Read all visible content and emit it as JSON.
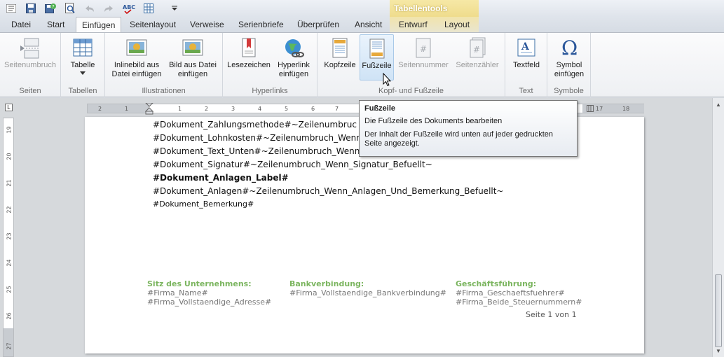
{
  "quick_access": {
    "items": [
      {
        "name": "app-menu-icon"
      },
      {
        "name": "save-icon"
      },
      {
        "name": "save-as-icon"
      },
      {
        "name": "print-preview-icon"
      },
      {
        "name": "undo-icon"
      },
      {
        "name": "redo-icon"
      },
      {
        "name": "spellcheck-icon",
        "label": "ABC"
      },
      {
        "name": "table-grid-icon"
      },
      {
        "name": "customize-dropdown-icon"
      }
    ],
    "contextual_title": "Tabellentools"
  },
  "tabs": [
    {
      "label": "Datei"
    },
    {
      "label": "Start"
    },
    {
      "label": "Einfügen",
      "active": true
    },
    {
      "label": "Seitenlayout"
    },
    {
      "label": "Verweise"
    },
    {
      "label": "Serienbriefe"
    },
    {
      "label": "Überprüfen"
    },
    {
      "label": "Ansicht"
    },
    {
      "label": "Entwurf"
    },
    {
      "label": "Layout"
    }
  ],
  "ribbon": {
    "groups": {
      "seiten": {
        "label": "Seiten",
        "buttons": {
          "seitenumbruch": "Seitenumbruch"
        }
      },
      "tabellen": {
        "label": "Tabellen",
        "buttons": {
          "tabelle": "Tabelle"
        }
      },
      "illustrationen": {
        "label": "Illustrationen",
        "buttons": {
          "inlinebild_l1": "Inlinebild aus",
          "inlinebild_l2": "Datei einfügen",
          "bild_l1": "Bild aus Datei",
          "bild_l2": "einfügen"
        }
      },
      "hyperlinks": {
        "label": "Hyperlinks",
        "buttons": {
          "lesezeichen": "Lesezeichen",
          "hyperlink_l1": "Hyperlink",
          "hyperlink_l2": "einfügen"
        }
      },
      "kopf_fuss": {
        "label": "Kopf- und Fußzeile",
        "buttons": {
          "kopfzeile": "Kopfzeile",
          "fusszeile": "Fußzeile",
          "seitennummer": "Seitennummer",
          "seitenzaehler": "Seitenzähler"
        }
      },
      "text": {
        "label": "Text",
        "buttons": {
          "textfeld": "Textfeld"
        }
      },
      "symbole": {
        "label": "Symbole",
        "buttons": {
          "symbol_l1": "Symbol",
          "symbol_l2": "einfügen"
        }
      }
    }
  },
  "ruler": {
    "horizontal_ticks": [
      "2",
      "1",
      "1",
      "2",
      "3",
      "4",
      "5",
      "6",
      "7",
      "17",
      "18"
    ],
    "vertical_ticks": [
      "19",
      "20",
      "21",
      "22",
      "23",
      "24",
      "25",
      "26",
      "27"
    ]
  },
  "document": {
    "lines": [
      "#Dokument_Zahlungsmethode#~Zeilenumbruc",
      "#Dokument_Lohnkosten#~Zeilenumbruch_Wenn",
      "#Dokument_Text_Unten#~Zeilenumbruch_Wenn",
      "#Dokument_Signatur#~Zeilenumbruch_Wenn_Signatur_Befuellt~",
      "#Dokument_Anlagen_Label#",
      "#Dokument_Anlagen#~Zeilenumbruch_Wenn_Anlagen_Und_Bemerkung_Befuellt~",
      "#Dokument_Bemerkung#"
    ],
    "footer": {
      "col1": {
        "heading": "Sitz des Unternehmens:",
        "line1": "#Firma_Name#",
        "line2": "#Firma_Vollstaendige_Adresse#"
      },
      "col2": {
        "heading": "Bankverbindung:",
        "line1": "#Firma_Vollstaendige_Bankverbindung#"
      },
      "col3": {
        "heading": "Geschäftsführung:",
        "line1": "#Firma_Geschaeftsfuehrer#",
        "line2": "#Firma_Beide_Steuernummern#"
      },
      "page_number": "Seite 1 von 1"
    }
  },
  "tooltip": {
    "title": "Fußzeile",
    "description": "Die Fußzeile des Dokuments bearbeiten",
    "detail": "Der Inhalt der Fußzeile wird unten auf jeder gedruckten Seite angezeigt."
  },
  "colors": {
    "footer_heading": "#7bb55f",
    "accent_blue": "#2b579a",
    "contextual_yellow": "#efdc8c"
  }
}
